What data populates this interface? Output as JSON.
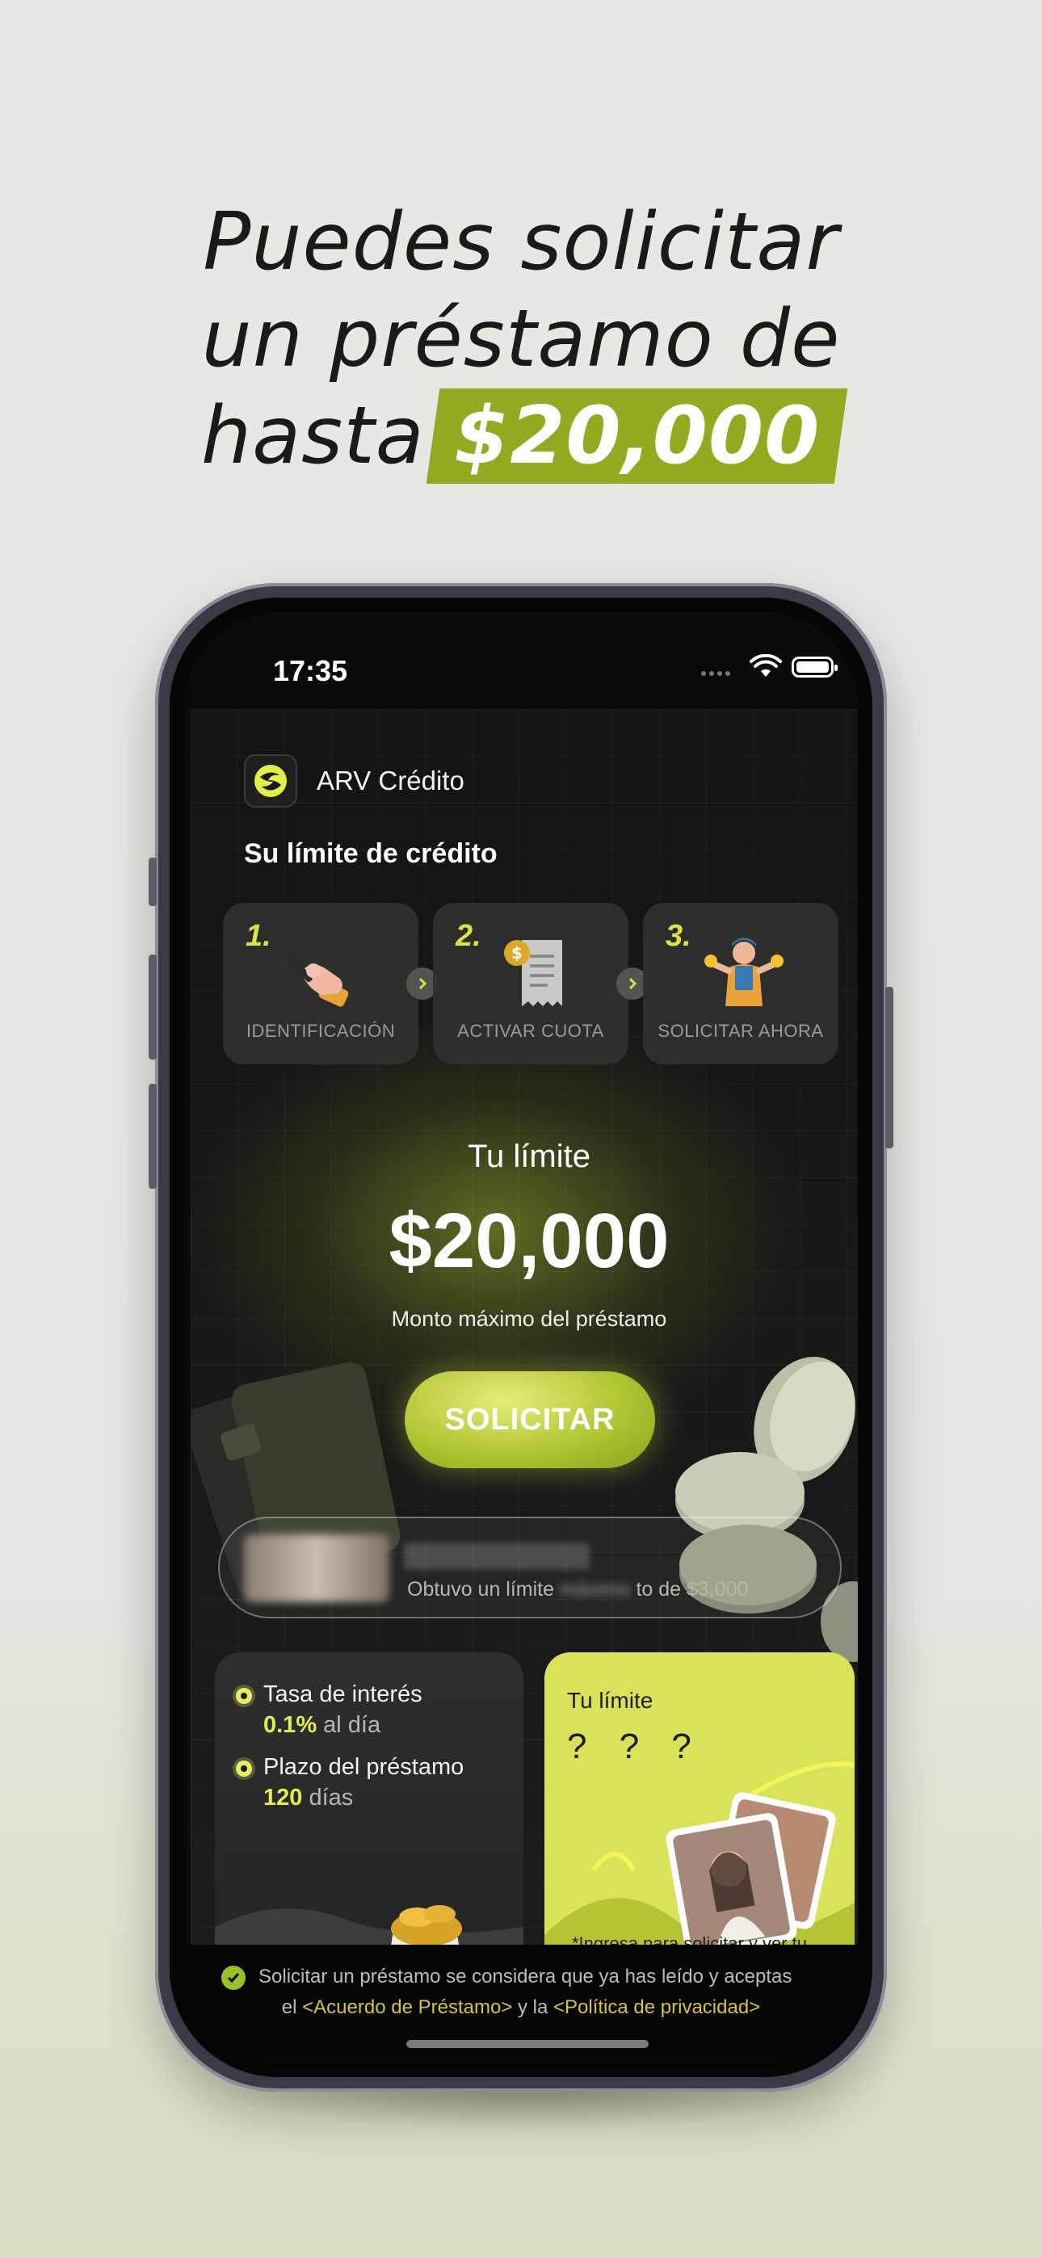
{
  "headline": {
    "line1": "Puedes solicitar",
    "line2": "un préstamo de",
    "line3_prefix": "hasta",
    "line3_amount": "$20,000"
  },
  "status_bar": {
    "time": "17:35"
  },
  "app": {
    "name": "ARV Crédito",
    "section_title": "Su límite de crédito",
    "steps": [
      {
        "number": "1.",
        "label": "IDENTIFICACIÓN",
        "icon": "hand-pen-icon"
      },
      {
        "number": "2.",
        "label": "ACTIVAR CUOTA",
        "icon": "receipt-coin-icon"
      },
      {
        "number": "3.",
        "label": "SOLICITAR AHORA",
        "icon": "person-coins-icon"
      }
    ],
    "limit": {
      "title": "Tu límite",
      "amount": "$20,000",
      "subtitle": "Monto máximo del préstamo"
    },
    "apply_button": "SOLICITAR",
    "ticker": {
      "text_prefix": "Obtuvo un límite",
      "text_blurred": "máximo",
      "text_suffix": "to de $3,000"
    },
    "info": {
      "rate_label": "Tasa de interés",
      "rate_value": "0.1%",
      "rate_unit": "al día",
      "term_label": "Plazo del préstamo",
      "term_value": "120",
      "term_unit": "días"
    },
    "promo": {
      "title": "Tu límite",
      "placeholder": "? ? ?",
      "note": "*Ingresa para solicitar y ver tu límite exclusivo"
    },
    "footer": {
      "line1": "Solicitar un préstamo se considera que ya has leído y aceptas",
      "line2_prefix": "el",
      "agreement_link": "<Acuerdo de Préstamo>",
      "line2_mid": "y la",
      "privacy_link": "<Política de privacidad>"
    }
  },
  "colors": {
    "accent": "#d9e24a",
    "headline_highlight": "#93ab21",
    "button": "#b3c433",
    "link": "#d7c43a"
  }
}
